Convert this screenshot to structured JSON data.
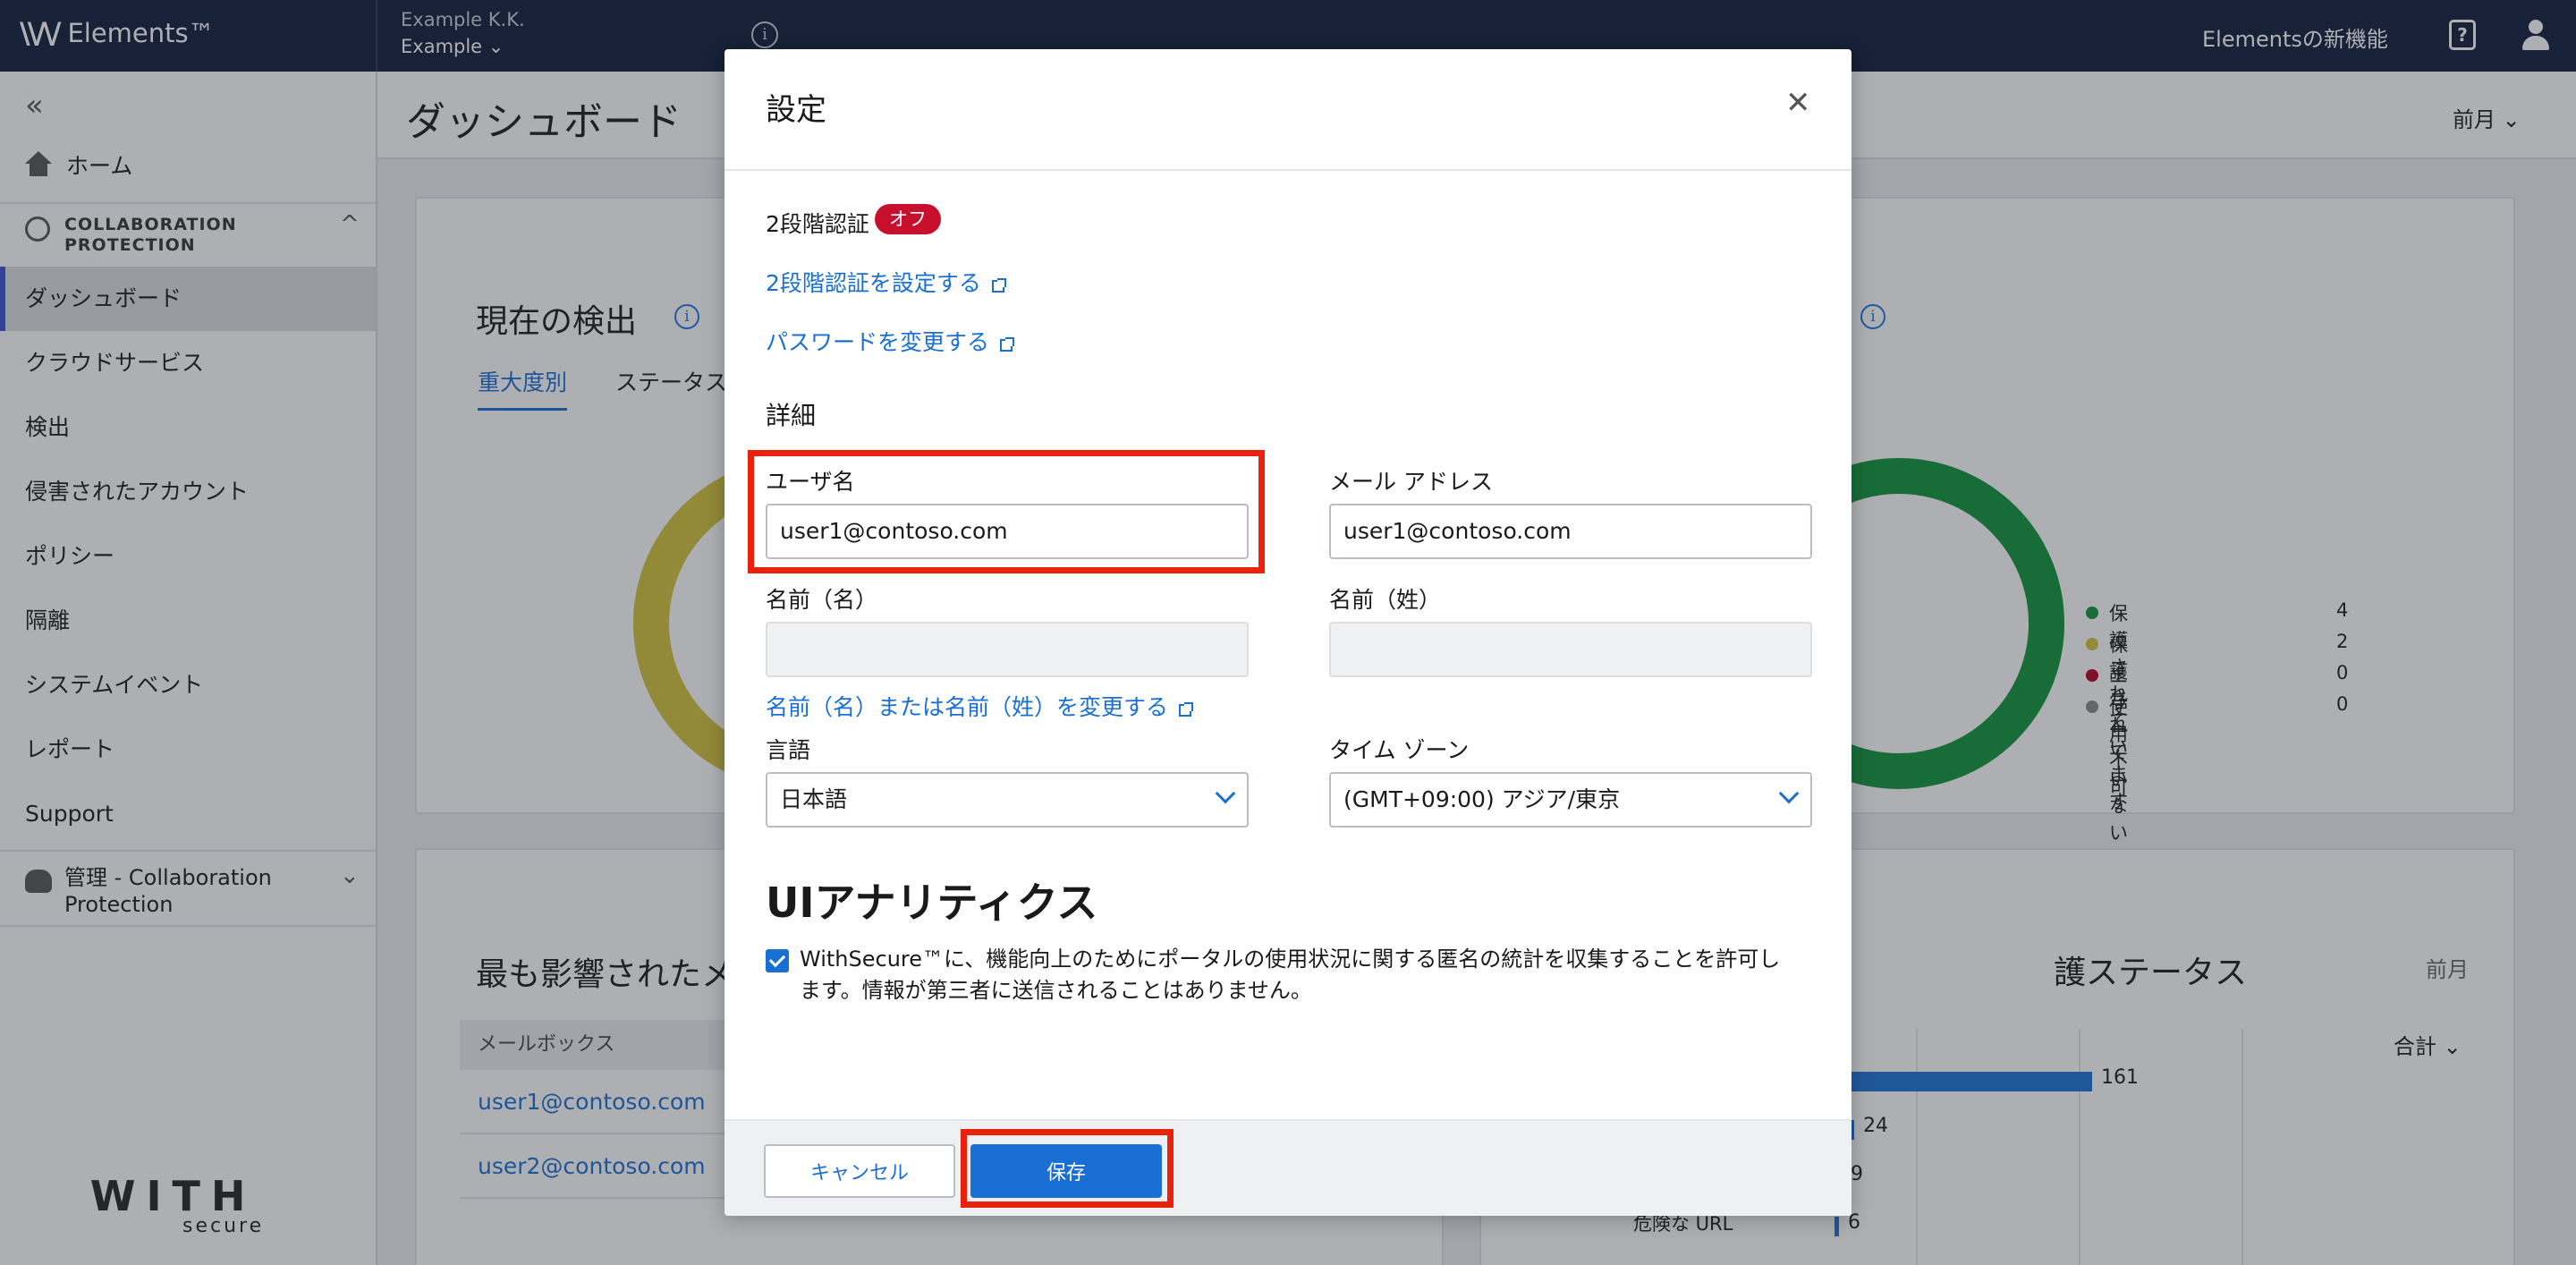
{
  "topbar": {
    "brand": "Elements™",
    "org_name": "Example K.K.",
    "org_selector": "Example",
    "whats_new": "Elementsの新機能"
  },
  "sidebar": {
    "home": "ホーム",
    "section1_line1": "COLLABORATION",
    "section1_line2": "PROTECTION",
    "items": [
      "ダッシュボード",
      "クラウドサービス",
      "検出",
      "侵害されたアカウント",
      "ポリシー",
      "隔離",
      "システムイベント",
      "レポート",
      "Support"
    ],
    "section2_line1": "管理 - Collaboration",
    "section2_line2": "Protection",
    "logo_word": "WITH",
    "logo_sub": "secure"
  },
  "page": {
    "title": "ダッシュボード",
    "period": "前月",
    "card1_title": "現在の検出",
    "tab1": "重大度別",
    "tab2": "ステータス別",
    "legend": [
      {
        "label": "保護されています",
        "value": "4",
        "color": "#10933a"
      },
      {
        "label": "保護されていない",
        "value": "2",
        "color": "#d4c43a"
      },
      {
        "label": "エラー",
        "value": "0",
        "color": "#b00020"
      },
      {
        "label": "使用不可",
        "value": "0",
        "color": "#888888"
      }
    ],
    "card2_title": "最も影響されたメー",
    "table_header": "メールボックス",
    "rows": [
      "user1@contoso.com",
      "user2@contoso.com"
    ],
    "card3_title": "護ステータス",
    "card3_period": "前月",
    "total_label": "合計",
    "bar_label": "危険な URL",
    "bars": [
      {
        "value": "161"
      },
      {
        "value": "24"
      },
      {
        "value": "9"
      },
      {
        "value": "6"
      }
    ]
  },
  "modal": {
    "title": "設定",
    "tfa_label": "2段階認証",
    "tfa_badge": "オフ",
    "tfa_link": "2段階認証を設定する",
    "pw_link": "パスワードを変更する",
    "details_title": "詳細",
    "username_label": "ユーザ名",
    "username_value": "user1@contoso.com",
    "email_label": "メール アドレス",
    "email_value": "user1@contoso.com",
    "firstname_label": "名前（名）",
    "firstname_value": "",
    "lastname_label": "名前（姓）",
    "lastname_value": "",
    "name_link": "名前（名）または名前（姓）を変更する",
    "language_label": "言語",
    "language_value": "日本語",
    "timezone_label": "タイム ゾーン",
    "timezone_value": "(GMT+09:00) アジア/東京",
    "ua_title": "UIアナリティクス",
    "consent_text": "WithSecure™に、機能向上のためにポータルの使用状況に関する匿名の統計を収集することを許可します。情報が第三者に送信されることはありません。",
    "cancel": "キャンセル",
    "save": "保存"
  }
}
